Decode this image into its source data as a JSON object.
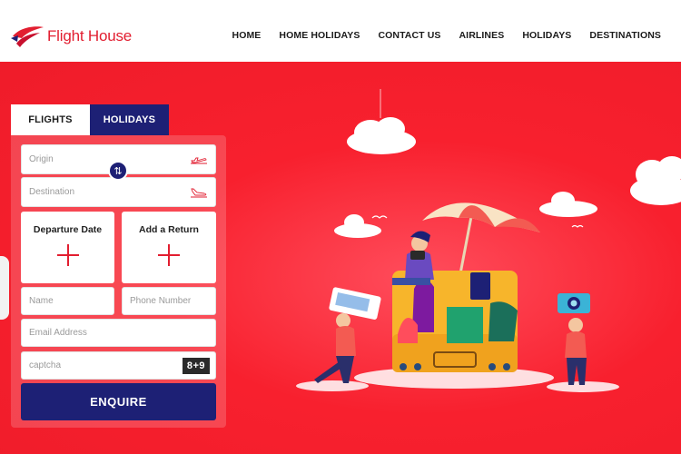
{
  "brand": {
    "name": "Flight House"
  },
  "nav": {
    "items": [
      "HOME",
      "HOME HOLIDAYS",
      "CONTACT US",
      "AIRLINES",
      "HOLIDAYS",
      "DESTINATIONS"
    ]
  },
  "tabs": [
    {
      "label": "FLIGHTS",
      "active": false
    },
    {
      "label": "HOLIDAYS",
      "active": true
    }
  ],
  "form": {
    "origin_placeholder": "Origin",
    "destination_placeholder": "Destination",
    "departure_label": "Departure Date",
    "return_label": "Add a Return",
    "name_placeholder": "Name",
    "phone_placeholder": "Phone Number",
    "email_placeholder": "Email Address",
    "captcha_placeholder": "captcha",
    "captcha_code": "8+9",
    "submit_label": "ENQUIRE"
  },
  "colors": {
    "brand_red": "#e21e30",
    "hero_red": "#f8202e",
    "navy": "#1d2075"
  },
  "icons": [
    "logo-wing-icon",
    "swap-icon",
    "takeoff-icon",
    "landing-icon",
    "plus-icon"
  ]
}
